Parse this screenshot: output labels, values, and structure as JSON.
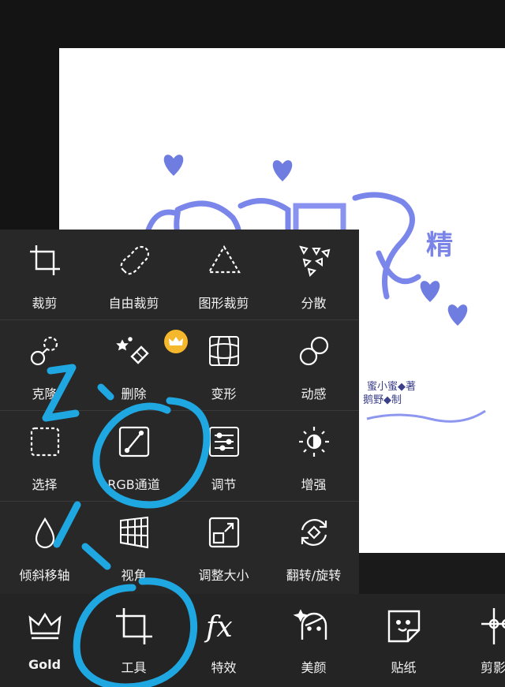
{
  "canvas": {
    "artwork_text_1": "精",
    "artwork_text_2": "蜜小蜜◆著",
    "artwork_text_3": "鹅野◆制"
  },
  "tools": [
    {
      "label": "裁剪",
      "icon": "crop-icon"
    },
    {
      "label": "自由裁剪",
      "icon": "freeform-crop-icon"
    },
    {
      "label": "图形裁剪",
      "icon": "shape-crop-icon"
    },
    {
      "label": "分散",
      "icon": "disperse-icon"
    },
    {
      "label": "克隆",
      "icon": "clone-icon"
    },
    {
      "label": "删除",
      "icon": "eraser-icon",
      "premium": true
    },
    {
      "label": "变形",
      "icon": "warp-icon"
    },
    {
      "label": "动感",
      "icon": "motion-icon"
    },
    {
      "label": "选择",
      "icon": "select-icon"
    },
    {
      "label": "RGB通道",
      "icon": "rgb-channel-icon"
    },
    {
      "label": "调节",
      "icon": "adjust-icon"
    },
    {
      "label": "增强",
      "icon": "enhance-icon"
    },
    {
      "label": "倾斜移轴",
      "icon": "tilt-shift-icon"
    },
    {
      "label": "视角",
      "icon": "perspective-icon"
    },
    {
      "label": "调整大小",
      "icon": "resize-icon"
    },
    {
      "label": "翻转/旋转",
      "icon": "flip-rotate-icon"
    }
  ],
  "nav": [
    {
      "label": "Gold",
      "icon": "crown-icon"
    },
    {
      "label": "工具",
      "icon": "crop-tool-icon"
    },
    {
      "label": "特效",
      "icon": "fx-icon"
    },
    {
      "label": "美颜",
      "icon": "beauty-face-icon"
    },
    {
      "label": "贴纸",
      "icon": "sticker-icon"
    },
    {
      "label": "剪影",
      "icon": "cutout-icon"
    }
  ],
  "annotation": {
    "color": "#1fa7e2"
  },
  "colors": {
    "premium_badge": "#f5b72b",
    "panel": "#282828",
    "nav": "#242424"
  }
}
